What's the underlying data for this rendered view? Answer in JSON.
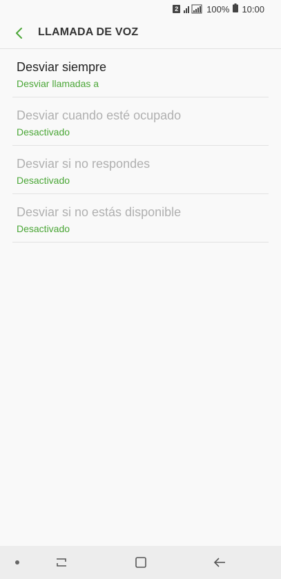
{
  "status_bar": {
    "sim_number": "2",
    "battery": "100%",
    "time": "10:00",
    "icons": [
      "sim-badge",
      "signal-icon",
      "battery-icon"
    ]
  },
  "header": {
    "title": "LLAMADA DE VOZ",
    "back_icon": "chevron-left-icon"
  },
  "items": [
    {
      "title": "Desviar siempre",
      "subtitle": "Desviar llamadas a",
      "enabled": true
    },
    {
      "title": "Desviar cuando esté ocupado",
      "subtitle": "Desactivado",
      "enabled": false
    },
    {
      "title": "Desviar si no respondes",
      "subtitle": "Desactivado",
      "enabled": false
    },
    {
      "title": "Desviar si no estás disponible",
      "subtitle": "Desactivado",
      "enabled": false
    }
  ],
  "colors": {
    "accent": "#4aa636",
    "background": "#f9f9f9",
    "disabled_text": "#b0b0b0",
    "primary_text": "#222222"
  },
  "nav_bar": {
    "icons": [
      "dot-icon",
      "recents-icon",
      "home-icon",
      "back-arrow-icon"
    ]
  }
}
